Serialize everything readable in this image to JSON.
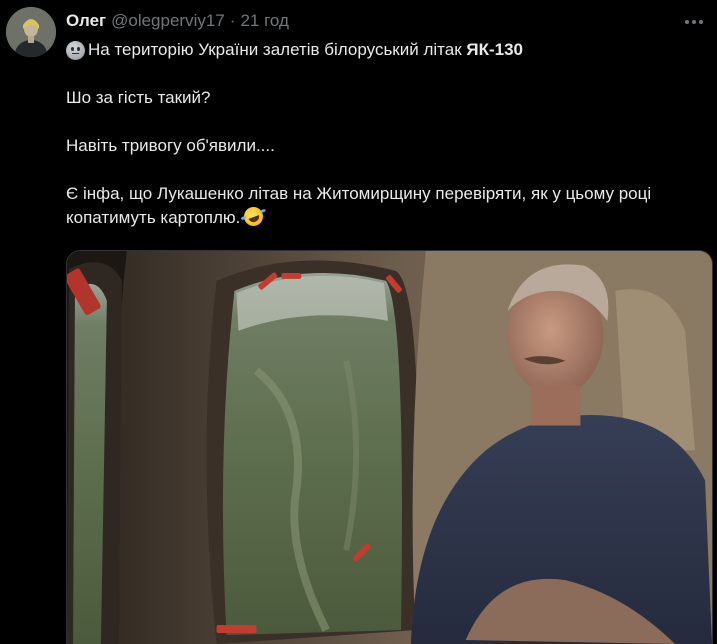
{
  "author": {
    "name": "Олег",
    "handle": "@olegperviy17",
    "separator": "·",
    "time": "21 год"
  },
  "icons": {
    "avatar": "user-avatar",
    "more": "more-horizontal-icon",
    "emoji_start": "slightly-smiling-face-emoji",
    "emoji_end": "rolling-on-floor-laughing-emoji"
  },
  "tweet": {
    "line1_text": "На територію України залетів білоруський літак ",
    "line1_bold": "ЯК-130",
    "line2": "Шо за гість такий?",
    "line3": "Навіть тривогу об'явили....",
    "line4": "Є інфа, що Лукашенко літав на Житомирщину перевіряти, як у цьому році копатимуть картоплю."
  },
  "colors": {
    "background": "#000000",
    "text": "#e7e9ea",
    "secondary": "#71767b"
  }
}
